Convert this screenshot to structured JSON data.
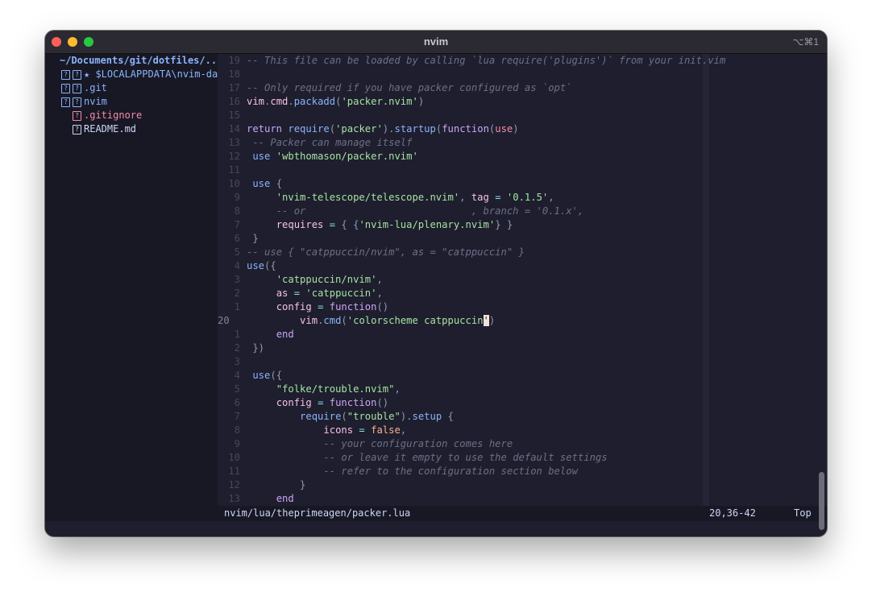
{
  "window": {
    "title": "nvim",
    "shortcut": "⌥⌘1"
  },
  "tree": {
    "root": "~/Documents/git/dotfiles/..",
    "items": [
      {
        "label": "★ $LOCALAPPDATA\\nvim-dat",
        "kind": "dir",
        "indent": 0
      },
      {
        "label": ".git",
        "kind": "dir",
        "indent": 0
      },
      {
        "label": "nvim",
        "kind": "dir",
        "indent": 0
      },
      {
        "label": ".gitignore",
        "kind": "git",
        "indent": 1
      },
      {
        "label": "README.md",
        "kind": "file",
        "indent": 1
      }
    ]
  },
  "editor": {
    "lines": [
      {
        "n": "19",
        "cur": false,
        "tokens": [
          [
            "c",
            "-- This file can be loaded by calling `lua require('plugins')` from your init.vim"
          ]
        ]
      },
      {
        "n": "18",
        "cur": false,
        "tokens": []
      },
      {
        "n": "17",
        "cur": false,
        "tokens": [
          [
            "c",
            "-- Only required if you have packer configured as `opt`"
          ]
        ]
      },
      {
        "n": "16",
        "cur": false,
        "tokens": [
          [
            "v",
            "vim"
          ],
          [
            "br",
            "."
          ],
          [
            "v",
            "cmd"
          ],
          [
            "br",
            "."
          ],
          [
            "f",
            "packadd"
          ],
          [
            "br",
            "("
          ],
          [
            "s",
            "'packer.nvim'"
          ],
          [
            "br",
            ")"
          ]
        ]
      },
      {
        "n": "15",
        "cur": false,
        "tokens": []
      },
      {
        "n": "14",
        "cur": false,
        "tokens": [
          [
            "k",
            "return "
          ],
          [
            "f",
            "require"
          ],
          [
            "br",
            "("
          ],
          [
            "s",
            "'packer'"
          ],
          [
            "br",
            ")."
          ],
          [
            "f",
            "startup"
          ],
          [
            "br",
            "("
          ],
          [
            "k",
            "function"
          ],
          [
            "br",
            "("
          ],
          [
            "p",
            "use"
          ],
          [
            "br",
            ")"
          ]
        ]
      },
      {
        "n": "13",
        "cur": false,
        "tokens": [
          [
            "",
            " "
          ],
          [
            "c",
            "-- Packer can manage itself"
          ]
        ]
      },
      {
        "n": "12",
        "cur": false,
        "tokens": [
          [
            "",
            " "
          ],
          [
            "f",
            "use "
          ],
          [
            "s",
            "'wbthomason/packer.nvim'"
          ]
        ]
      },
      {
        "n": "11",
        "cur": false,
        "tokens": []
      },
      {
        "n": "10",
        "cur": false,
        "tokens": [
          [
            "",
            " "
          ],
          [
            "f",
            "use "
          ],
          [
            "br",
            "{"
          ]
        ]
      },
      {
        "n": "9",
        "cur": false,
        "tokens": [
          [
            "",
            "     "
          ],
          [
            "s",
            "'nvim-telescope/telescope.nvim'"
          ],
          [
            "br",
            ", "
          ],
          [
            "v",
            "tag "
          ],
          [
            "o",
            "= "
          ],
          [
            "s",
            "'0.1.5'"
          ],
          [
            "br",
            ","
          ]
        ]
      },
      {
        "n": "8",
        "cur": false,
        "tokens": [
          [
            "",
            "     "
          ],
          [
            "c",
            "-- or                            , branch = '0.1.x',"
          ]
        ]
      },
      {
        "n": "7",
        "cur": false,
        "tokens": [
          [
            "",
            "     "
          ],
          [
            "v",
            "requires "
          ],
          [
            "o",
            "= "
          ],
          [
            "br",
            "{ {"
          ],
          [
            "s",
            "'nvim-lua/plenary.nvim'"
          ],
          [
            "br",
            "} }"
          ]
        ]
      },
      {
        "n": "6",
        "cur": false,
        "tokens": [
          [
            "",
            " "
          ],
          [
            "br",
            "}"
          ]
        ]
      },
      {
        "n": "5",
        "cur": false,
        "tokens": [
          [
            "c",
            "-- use { \"catppuccin/nvim\", as = \"catppuccin\" }"
          ]
        ]
      },
      {
        "n": "4",
        "cur": false,
        "tokens": [
          [
            "f",
            "use"
          ],
          [
            "br",
            "({"
          ]
        ]
      },
      {
        "n": "3",
        "cur": false,
        "tokens": [
          [
            "",
            "     "
          ],
          [
            "s",
            "'catppuccin/nvim'"
          ],
          [
            "br",
            ","
          ]
        ]
      },
      {
        "n": "2",
        "cur": false,
        "tokens": [
          [
            "",
            "     "
          ],
          [
            "v",
            "as "
          ],
          [
            "o",
            "= "
          ],
          [
            "s",
            "'catppuccin'"
          ],
          [
            "br",
            ","
          ]
        ]
      },
      {
        "n": "1",
        "cur": false,
        "tokens": [
          [
            "",
            "     "
          ],
          [
            "v",
            "config "
          ],
          [
            "o",
            "= "
          ],
          [
            "k",
            "function"
          ],
          [
            "br",
            "()"
          ]
        ]
      },
      {
        "n": "20",
        "cur": true,
        "tokens": [
          [
            "",
            "         "
          ],
          [
            "v",
            "vim"
          ],
          [
            "br",
            "."
          ],
          [
            "f",
            "cmd"
          ],
          [
            "br",
            "("
          ],
          [
            "s",
            "'colorscheme catppuccin"
          ],
          [
            "cursor",
            "'"
          ],
          [
            "br",
            ")"
          ]
        ]
      },
      {
        "n": "1",
        "cur": false,
        "tokens": [
          [
            "",
            "     "
          ],
          [
            "k",
            "end"
          ]
        ]
      },
      {
        "n": "2",
        "cur": false,
        "tokens": [
          [
            "",
            " "
          ],
          [
            "br",
            "})"
          ]
        ]
      },
      {
        "n": "3",
        "cur": false,
        "tokens": []
      },
      {
        "n": "4",
        "cur": false,
        "tokens": [
          [
            "",
            " "
          ],
          [
            "f",
            "use"
          ],
          [
            "br",
            "({"
          ]
        ]
      },
      {
        "n": "5",
        "cur": false,
        "tokens": [
          [
            "",
            "     "
          ],
          [
            "s",
            "\"folke/trouble.nvim\""
          ],
          [
            "br",
            ","
          ]
        ]
      },
      {
        "n": "6",
        "cur": false,
        "tokens": [
          [
            "",
            "     "
          ],
          [
            "v",
            "config "
          ],
          [
            "o",
            "= "
          ],
          [
            "k",
            "function"
          ],
          [
            "br",
            "()"
          ]
        ]
      },
      {
        "n": "7",
        "cur": false,
        "tokens": [
          [
            "",
            "         "
          ],
          [
            "f",
            "require"
          ],
          [
            "br",
            "("
          ],
          [
            "s",
            "\"trouble\""
          ],
          [
            "br",
            ")."
          ],
          [
            "f",
            "setup "
          ],
          [
            "br",
            "{"
          ]
        ]
      },
      {
        "n": "8",
        "cur": false,
        "tokens": [
          [
            "",
            "             "
          ],
          [
            "v",
            "icons "
          ],
          [
            "o",
            "= "
          ],
          [
            "b",
            "false"
          ],
          [
            "br",
            ","
          ]
        ]
      },
      {
        "n": "9",
        "cur": false,
        "tokens": [
          [
            "",
            "             "
          ],
          [
            "c",
            "-- your configuration comes here"
          ]
        ]
      },
      {
        "n": "10",
        "cur": false,
        "tokens": [
          [
            "",
            "             "
          ],
          [
            "c",
            "-- or leave it empty to use the default settings"
          ]
        ]
      },
      {
        "n": "11",
        "cur": false,
        "tokens": [
          [
            "",
            "             "
          ],
          [
            "c",
            "-- refer to the configuration section below"
          ]
        ]
      },
      {
        "n": "12",
        "cur": false,
        "tokens": [
          [
            "",
            "         "
          ],
          [
            "br",
            "}"
          ]
        ]
      },
      {
        "n": "13",
        "cur": false,
        "tokens": [
          [
            "",
            "     "
          ],
          [
            "k",
            "end"
          ]
        ]
      }
    ]
  },
  "status": {
    "file": "nvim/lua/theprimeagen/packer.lua",
    "position": "20,36-42",
    "percent": "Top"
  }
}
